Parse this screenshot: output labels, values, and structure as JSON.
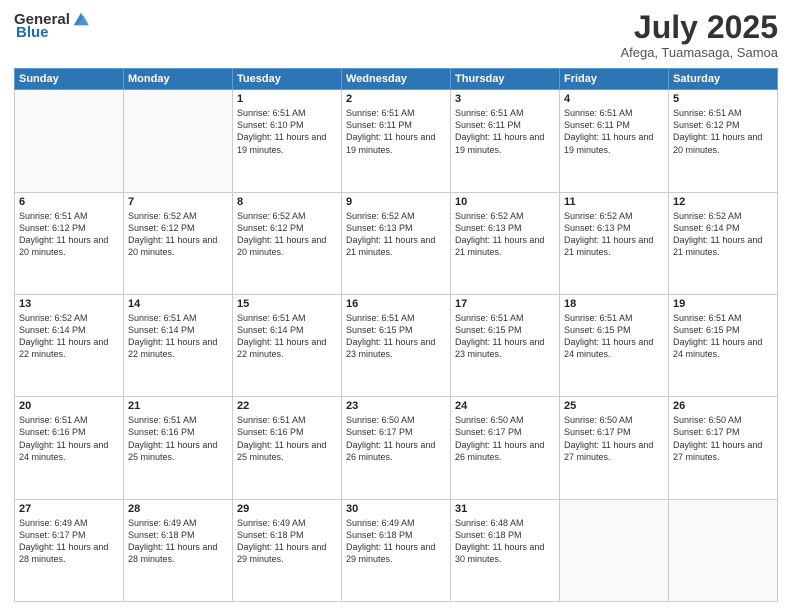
{
  "header": {
    "logo_general": "General",
    "logo_blue": "Blue",
    "month": "July 2025",
    "location": "Afega, Tuamasaga, Samoa"
  },
  "weekdays": [
    "Sunday",
    "Monday",
    "Tuesday",
    "Wednesday",
    "Thursday",
    "Friday",
    "Saturday"
  ],
  "weeks": [
    [
      {
        "day": "",
        "sunrise": "",
        "sunset": "",
        "daylight": ""
      },
      {
        "day": "",
        "sunrise": "",
        "sunset": "",
        "daylight": ""
      },
      {
        "day": "1",
        "sunrise": "Sunrise: 6:51 AM",
        "sunset": "Sunset: 6:10 PM",
        "daylight": "Daylight: 11 hours and 19 minutes."
      },
      {
        "day": "2",
        "sunrise": "Sunrise: 6:51 AM",
        "sunset": "Sunset: 6:11 PM",
        "daylight": "Daylight: 11 hours and 19 minutes."
      },
      {
        "day": "3",
        "sunrise": "Sunrise: 6:51 AM",
        "sunset": "Sunset: 6:11 PM",
        "daylight": "Daylight: 11 hours and 19 minutes."
      },
      {
        "day": "4",
        "sunrise": "Sunrise: 6:51 AM",
        "sunset": "Sunset: 6:11 PM",
        "daylight": "Daylight: 11 hours and 19 minutes."
      },
      {
        "day": "5",
        "sunrise": "Sunrise: 6:51 AM",
        "sunset": "Sunset: 6:12 PM",
        "daylight": "Daylight: 11 hours and 20 minutes."
      }
    ],
    [
      {
        "day": "6",
        "sunrise": "Sunrise: 6:51 AM",
        "sunset": "Sunset: 6:12 PM",
        "daylight": "Daylight: 11 hours and 20 minutes."
      },
      {
        "day": "7",
        "sunrise": "Sunrise: 6:52 AM",
        "sunset": "Sunset: 6:12 PM",
        "daylight": "Daylight: 11 hours and 20 minutes."
      },
      {
        "day": "8",
        "sunrise": "Sunrise: 6:52 AM",
        "sunset": "Sunset: 6:12 PM",
        "daylight": "Daylight: 11 hours and 20 minutes."
      },
      {
        "day": "9",
        "sunrise": "Sunrise: 6:52 AM",
        "sunset": "Sunset: 6:13 PM",
        "daylight": "Daylight: 11 hours and 21 minutes."
      },
      {
        "day": "10",
        "sunrise": "Sunrise: 6:52 AM",
        "sunset": "Sunset: 6:13 PM",
        "daylight": "Daylight: 11 hours and 21 minutes."
      },
      {
        "day": "11",
        "sunrise": "Sunrise: 6:52 AM",
        "sunset": "Sunset: 6:13 PM",
        "daylight": "Daylight: 11 hours and 21 minutes."
      },
      {
        "day": "12",
        "sunrise": "Sunrise: 6:52 AM",
        "sunset": "Sunset: 6:14 PM",
        "daylight": "Daylight: 11 hours and 21 minutes."
      }
    ],
    [
      {
        "day": "13",
        "sunrise": "Sunrise: 6:52 AM",
        "sunset": "Sunset: 6:14 PM",
        "daylight": "Daylight: 11 hours and 22 minutes."
      },
      {
        "day": "14",
        "sunrise": "Sunrise: 6:51 AM",
        "sunset": "Sunset: 6:14 PM",
        "daylight": "Daylight: 11 hours and 22 minutes."
      },
      {
        "day": "15",
        "sunrise": "Sunrise: 6:51 AM",
        "sunset": "Sunset: 6:14 PM",
        "daylight": "Daylight: 11 hours and 22 minutes."
      },
      {
        "day": "16",
        "sunrise": "Sunrise: 6:51 AM",
        "sunset": "Sunset: 6:15 PM",
        "daylight": "Daylight: 11 hours and 23 minutes."
      },
      {
        "day": "17",
        "sunrise": "Sunrise: 6:51 AM",
        "sunset": "Sunset: 6:15 PM",
        "daylight": "Daylight: 11 hours and 23 minutes."
      },
      {
        "day": "18",
        "sunrise": "Sunrise: 6:51 AM",
        "sunset": "Sunset: 6:15 PM",
        "daylight": "Daylight: 11 hours and 24 minutes."
      },
      {
        "day": "19",
        "sunrise": "Sunrise: 6:51 AM",
        "sunset": "Sunset: 6:15 PM",
        "daylight": "Daylight: 11 hours and 24 minutes."
      }
    ],
    [
      {
        "day": "20",
        "sunrise": "Sunrise: 6:51 AM",
        "sunset": "Sunset: 6:16 PM",
        "daylight": "Daylight: 11 hours and 24 minutes."
      },
      {
        "day": "21",
        "sunrise": "Sunrise: 6:51 AM",
        "sunset": "Sunset: 6:16 PM",
        "daylight": "Daylight: 11 hours and 25 minutes."
      },
      {
        "day": "22",
        "sunrise": "Sunrise: 6:51 AM",
        "sunset": "Sunset: 6:16 PM",
        "daylight": "Daylight: 11 hours and 25 minutes."
      },
      {
        "day": "23",
        "sunrise": "Sunrise: 6:50 AM",
        "sunset": "Sunset: 6:17 PM",
        "daylight": "Daylight: 11 hours and 26 minutes."
      },
      {
        "day": "24",
        "sunrise": "Sunrise: 6:50 AM",
        "sunset": "Sunset: 6:17 PM",
        "daylight": "Daylight: 11 hours and 26 minutes."
      },
      {
        "day": "25",
        "sunrise": "Sunrise: 6:50 AM",
        "sunset": "Sunset: 6:17 PM",
        "daylight": "Daylight: 11 hours and 27 minutes."
      },
      {
        "day": "26",
        "sunrise": "Sunrise: 6:50 AM",
        "sunset": "Sunset: 6:17 PM",
        "daylight": "Daylight: 11 hours and 27 minutes."
      }
    ],
    [
      {
        "day": "27",
        "sunrise": "Sunrise: 6:49 AM",
        "sunset": "Sunset: 6:17 PM",
        "daylight": "Daylight: 11 hours and 28 minutes."
      },
      {
        "day": "28",
        "sunrise": "Sunrise: 6:49 AM",
        "sunset": "Sunset: 6:18 PM",
        "daylight": "Daylight: 11 hours and 28 minutes."
      },
      {
        "day": "29",
        "sunrise": "Sunrise: 6:49 AM",
        "sunset": "Sunset: 6:18 PM",
        "daylight": "Daylight: 11 hours and 29 minutes."
      },
      {
        "day": "30",
        "sunrise": "Sunrise: 6:49 AM",
        "sunset": "Sunset: 6:18 PM",
        "daylight": "Daylight: 11 hours and 29 minutes."
      },
      {
        "day": "31",
        "sunrise": "Sunrise: 6:48 AM",
        "sunset": "Sunset: 6:18 PM",
        "daylight": "Daylight: 11 hours and 30 minutes."
      },
      {
        "day": "",
        "sunrise": "",
        "sunset": "",
        "daylight": ""
      },
      {
        "day": "",
        "sunrise": "",
        "sunset": "",
        "daylight": ""
      }
    ]
  ]
}
